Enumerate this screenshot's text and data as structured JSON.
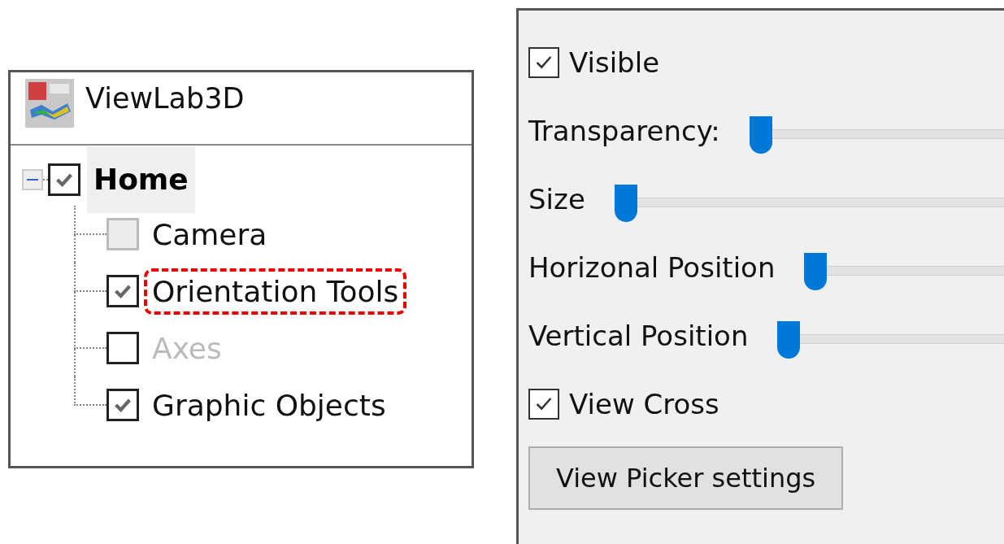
{
  "tree_panel": {
    "app_title": "ViewLab3D",
    "root": {
      "label": "Home",
      "expanded": true,
      "checked": true,
      "selected": true,
      "children": [
        {
          "label": "Camera",
          "checked": false,
          "box_disabled": true,
          "greyed": false,
          "highlighted": false
        },
        {
          "label": "Orientation Tools",
          "checked": true,
          "box_disabled": false,
          "greyed": false,
          "highlighted": true
        },
        {
          "label": "Axes",
          "checked": false,
          "box_disabled": false,
          "greyed": true,
          "highlighted": false
        },
        {
          "label": "Graphic Objects",
          "checked": true,
          "box_disabled": false,
          "greyed": false,
          "highlighted": false
        }
      ]
    }
  },
  "properties_panel": {
    "rows": [
      {
        "kind": "checkbox",
        "label": "Visible",
        "checked": true
      },
      {
        "kind": "slider",
        "label": "Transparency:",
        "level": 0
      },
      {
        "kind": "slider",
        "label": "Size",
        "level": 0
      },
      {
        "kind": "slider",
        "label": "Horizonal Position",
        "level": 0
      },
      {
        "kind": "slider",
        "label": "Vertical Position",
        "level": 0
      },
      {
        "kind": "checkbox",
        "label": "View Cross",
        "checked": true
      },
      {
        "kind": "button",
        "label": "View Picker settings"
      }
    ]
  }
}
